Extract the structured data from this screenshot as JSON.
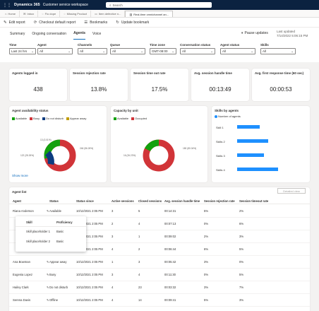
{
  "topbar": {
    "brand": "Dynamics 365",
    "app": "Customer service workspace",
    "search_placeholder": "Search"
  },
  "tabs": [
    {
      "label": "Home"
    },
    {
      "label": "Inbox"
    },
    {
      "label": "Flo dope"
    },
    {
      "label": "Missing Product"
    },
    {
      "label": "Item defective n..."
    },
    {
      "label": "Real-time omnichannel an..."
    }
  ],
  "commands": {
    "edit": "Edit report",
    "checkout": "Checkout default report",
    "bookmarks": "Bookmarks",
    "update": "Update bookmark"
  },
  "subnav": [
    "Summary",
    "Ongoing conversation",
    "Agents",
    "Voice"
  ],
  "pause_updates": "Pause updates",
  "last_updated": {
    "label": "Last updated",
    "value": "7/14/2022 5:06:15 PM"
  },
  "filters": [
    {
      "label": "Time",
      "value": "Last 24 hrs"
    },
    {
      "label": "Agent",
      "value": "All"
    },
    {
      "label": "Channels",
      "value": "All"
    },
    {
      "label": "Queue",
      "value": "All"
    },
    {
      "label": "Time zone",
      "value": "GMT-08:00"
    },
    {
      "label": "Conversation status",
      "value": "All"
    },
    {
      "label": "Agent status",
      "value": "All"
    },
    {
      "label": "Skills",
      "value": "All"
    }
  ],
  "kpis": [
    {
      "label": "Agents logged in",
      "value": "438"
    },
    {
      "label": "Session rejection rate",
      "value": "13.8%"
    },
    {
      "label": "Session time out rate",
      "value": "17.5%"
    },
    {
      "label": "Avg. session handle time",
      "value": "00:13:49"
    },
    {
      "label": "Avg. first response time (60 sec)",
      "value": "00:00:53"
    }
  ],
  "availability": {
    "title": "Agent availability status",
    "legend": [
      "Available",
      "Busy",
      "Do not disturb",
      "Appear away"
    ],
    "labels": [
      "122 (28.26%)",
      "13 (3.01%)",
      "246 (56.26%)"
    ],
    "show_more": "Show more"
  },
  "capacity": {
    "title": "Capacity by unit",
    "legend": [
      "Available",
      "Occupied"
    ],
    "labels": [
      "16 (26.23%)",
      "180 (80.04%)"
    ]
  },
  "skills": {
    "title": "Skills by agents",
    "legend": "Number of agents",
    "bars": [
      {
        "label": "Skill 1"
      },
      {
        "label": "Skills 2"
      },
      {
        "label": "Skills 3"
      },
      {
        "label": "Skills 4"
      }
    ]
  },
  "agent_list": {
    "title": "Agent list",
    "detailed_view": "Detailed view",
    "columns": [
      "Agent",
      "Status",
      "Status since",
      "Active sessions",
      "Closed sessions",
      "Avg. session handle time",
      "Session rejection rate",
      "Session timeout rate"
    ],
    "rows": [
      {
        "agent": "Riana Anderson",
        "status": "Available",
        "since": "10/12/2021 2:05 PM",
        "active": "3",
        "closed": "5",
        "aht": "00:14:31",
        "rej": "5%",
        "tout": "2%"
      },
      {
        "agent": "",
        "status": "",
        "since": "10/12/2021 2:05 PM",
        "active": "2",
        "closed": "4",
        "aht": "00:07:13",
        "rej": "0%",
        "tout": "6%"
      },
      {
        "agent": "",
        "status": "",
        "since": "10/12/2021 2:05 PM",
        "active": "3",
        "closed": "1",
        "aht": "00:09:02",
        "rej": "2%",
        "tout": "3%"
      },
      {
        "agent": "",
        "status": "",
        "since": "10/12/2021 2:05 PM",
        "active": "4",
        "closed": "2",
        "aht": "00:06:44",
        "rej": "6%",
        "tout": "5%"
      },
      {
        "agent": "Ana Bowman",
        "status": "Appear away",
        "since": "10/12/2021 2:05 PM",
        "active": "1",
        "closed": "3",
        "aht": "00:05:42",
        "rej": "3%",
        "tout": "0%"
      },
      {
        "agent": "Eugenia Lopez",
        "status": "Busy",
        "since": "10/12/2021 2:05 PM",
        "active": "3",
        "closed": "4",
        "aht": "00:11:30",
        "rej": "0%",
        "tout": "5%"
      },
      {
        "agent": "Hailey Clark",
        "status": "Do not disturb",
        "since": "10/12/2021 2:05 PM",
        "active": "4",
        "closed": "23",
        "aht": "00:03:32",
        "rej": "3%",
        "tout": "7%"
      },
      {
        "agent": "Serena Davis",
        "status": "Offline",
        "since": "10/12/2021 2:05 PM",
        "active": "4",
        "closed": "14",
        "aht": "00:09:41",
        "rej": "5%",
        "tout": "3%"
      }
    ]
  },
  "popup": {
    "headers": [
      "Skill",
      "Proficiency"
    ],
    "rows": [
      {
        "skill": "Skill placeholder 1",
        "prof": "Basic"
      },
      {
        "skill": "Skill placeholder 2",
        "prof": "Basic"
      }
    ]
  },
  "colors": {
    "available": "#13a10e",
    "busy": "#d13438",
    "dnd": "#0c3b7f",
    "away": "#c19c00",
    "occupied": "#d13438",
    "bar": "#1e90ff"
  }
}
